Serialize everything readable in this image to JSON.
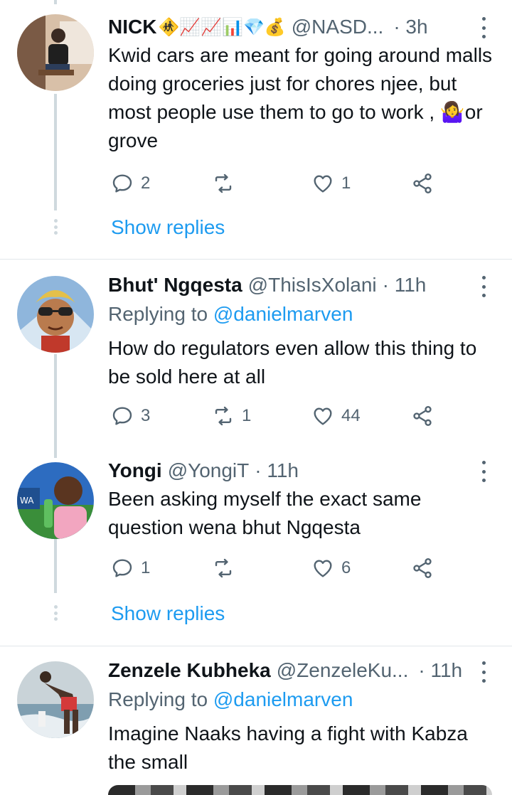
{
  "tweets": [
    {
      "name": "NICK",
      "name_emojis": "🚸📈📈📊💎💰",
      "handle": "@NASD...",
      "time": "· 3h",
      "reply_to_prefix": "",
      "reply_to_handle": "",
      "text": "Kwid cars are meant for going around malls doing groceries just for chores njee, but most people use them to go to work , 🤷‍♀️or grove",
      "replies": "2",
      "retweets": "",
      "likes": "1"
    },
    {
      "name": "Bhut' Ngqesta",
      "handle": "@ThisIsXolani",
      "time": "· 11h",
      "reply_to_prefix": "Replying to",
      "reply_to_handle": "@danielmarven",
      "text": "How do regulators even allow this thing to be sold here at all",
      "replies": "3",
      "retweets": "1",
      "likes": "44"
    },
    {
      "name": "Yongi",
      "handle": "@YongiT",
      "time": "· 11h",
      "text": "Been asking myself the exact same question wena bhut Ngqesta",
      "replies": "1",
      "retweets": "",
      "likes": "6"
    },
    {
      "name": "Zenzele Kubheka",
      "handle": "@ZenzeleKu...",
      "time": "· 11h",
      "reply_to_prefix": "Replying to",
      "reply_to_handle": "@danielmarven",
      "text": "Imagine Naaks having a fight with Kabza the small"
    }
  ],
  "show_replies_label": "Show replies",
  "colors": {
    "accent": "#1d9bf0",
    "secondary_text": "#536471",
    "thread_line": "#cfd9de"
  },
  "icons": {
    "reply": "reply-icon",
    "retweet": "retweet-icon",
    "like": "heart-icon",
    "share": "share-icon",
    "more": "more-icon"
  }
}
